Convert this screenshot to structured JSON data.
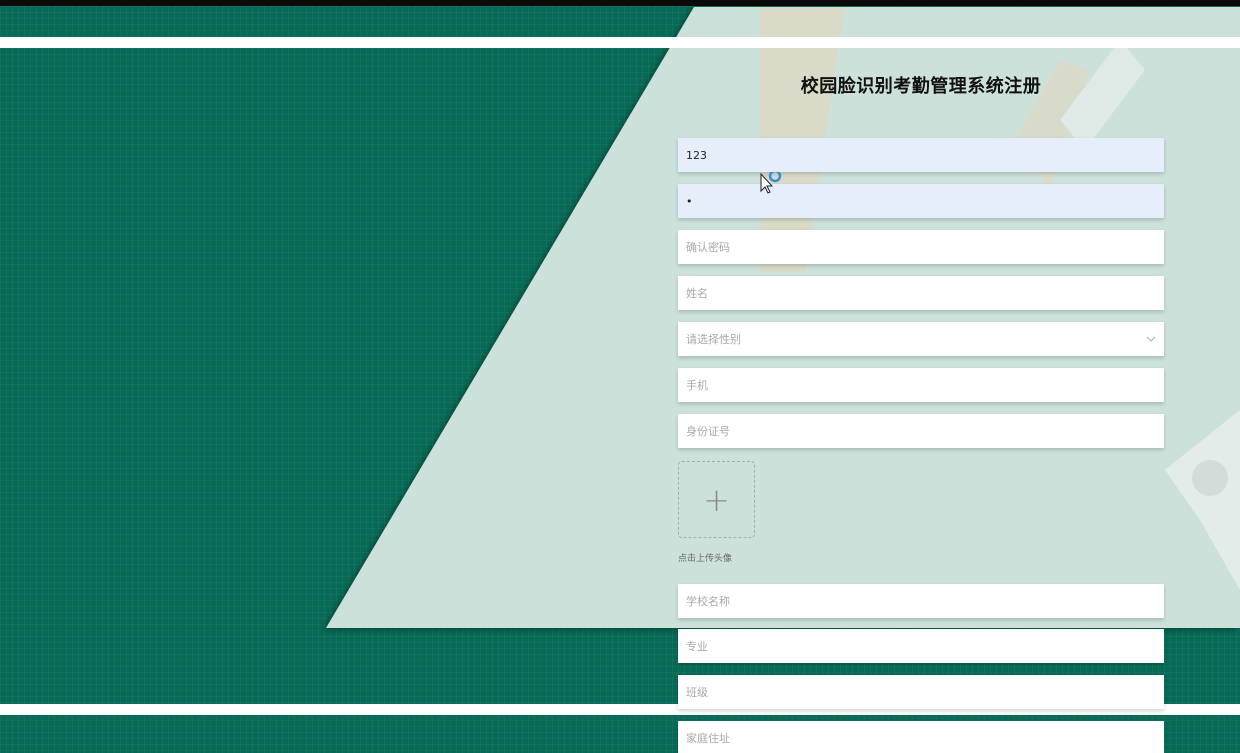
{
  "page": {
    "title": "校园脸识别考勤管理系统注册"
  },
  "colors": {
    "background": "#066a56",
    "panel": "#cde1db",
    "stripe": "#ffffff",
    "filled_input": "#e6eefc"
  },
  "form": {
    "username_value": "123",
    "password_value": "•",
    "confirm_password_placeholder": "确认密码",
    "name_placeholder": "姓名",
    "gender_placeholder": "请选择性别",
    "phone_placeholder": "手机",
    "id_card_placeholder": "身份证号",
    "upload_icon": "+",
    "upload_label": "点击上传头像",
    "school_placeholder": "学校名称",
    "major_placeholder": "专业",
    "class_placeholder": "班级",
    "address_placeholder": "家庭住址"
  },
  "icons": {
    "select_chevron": "chevron-down-icon",
    "upload": "plus-icon",
    "cursor": "mouse-pointer-icon"
  }
}
